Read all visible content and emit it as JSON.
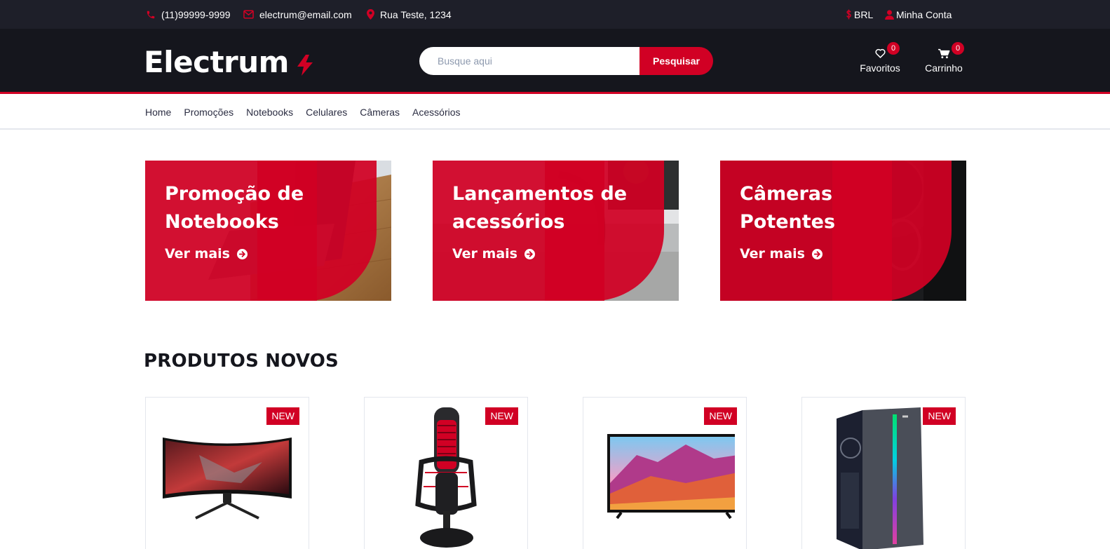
{
  "topbar": {
    "phone": "(11)99999-9999",
    "email": "electrum@email.com",
    "address": "Rua Teste, 1234",
    "currency": "BRL",
    "account": "Minha Conta"
  },
  "header": {
    "logo": "Electrum",
    "search_placeholder": "Busque aqui",
    "search_button": "Pesquisar",
    "wishlist_label": "Favoritos",
    "wishlist_count": "0",
    "cart_label": "Carrinho",
    "cart_count": "0"
  },
  "nav": {
    "items": [
      "Home",
      "Promoções",
      "Notebooks",
      "Celulares",
      "Câmeras",
      "Acessórios"
    ]
  },
  "banners": [
    {
      "title": "Promoção de Notebooks",
      "link": "Ver mais"
    },
    {
      "title": "Lançamentos de acessórios",
      "link": "Ver mais"
    },
    {
      "title": "Câmeras Potentes",
      "link": "Ver mais"
    }
  ],
  "section": {
    "title": "PRODUTOS NOVOS"
  },
  "products": [
    {
      "badge": "NEW",
      "image": "curved-monitor"
    },
    {
      "badge": "NEW",
      "image": "microphone"
    },
    {
      "badge": "NEW",
      "image": "television"
    },
    {
      "badge": "NEW",
      "image": "pc-case"
    }
  ],
  "colors": {
    "accent": "#D10024",
    "header_bg": "#15161D",
    "topbar_bg": "#1E1F29"
  }
}
